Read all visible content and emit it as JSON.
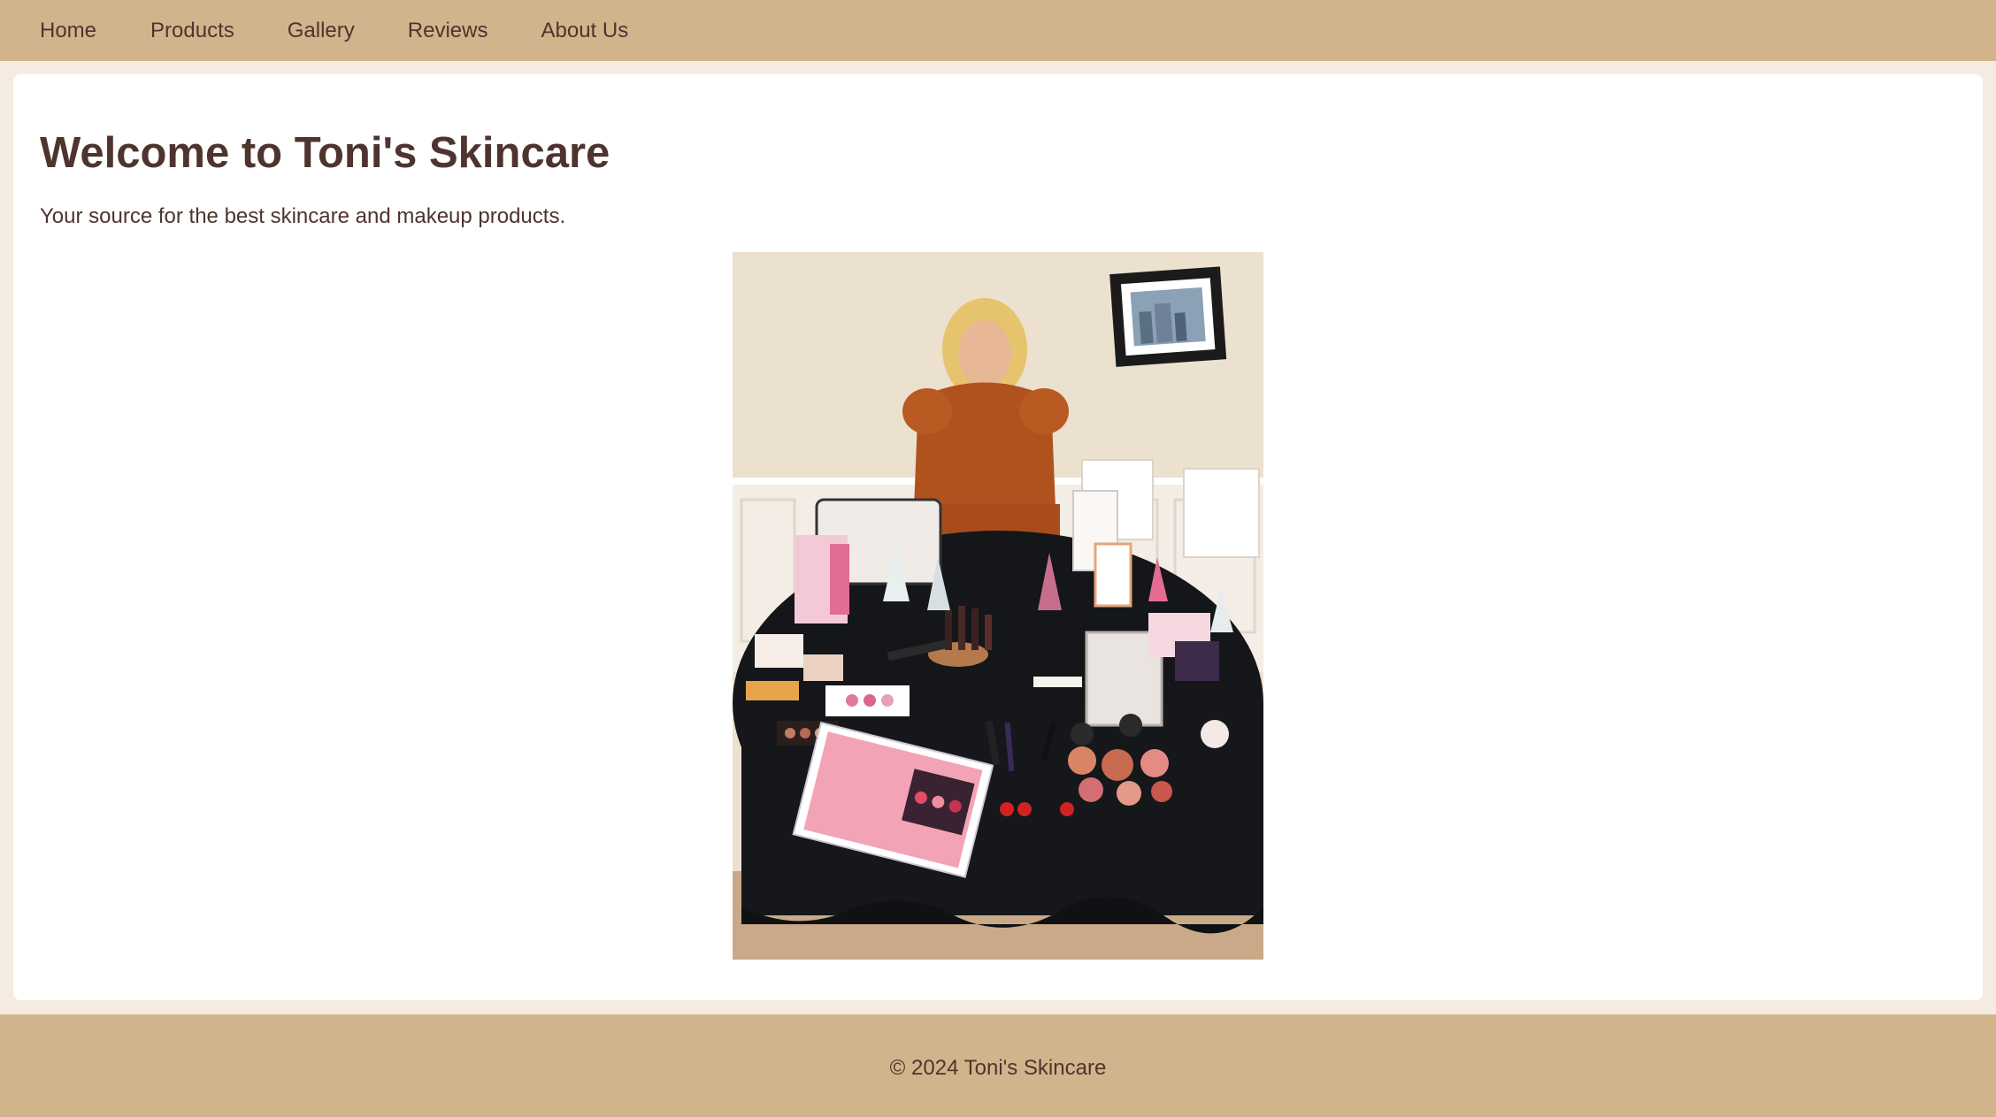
{
  "nav": {
    "items": [
      {
        "label": "Home"
      },
      {
        "label": "Products"
      },
      {
        "label": "Gallery"
      },
      {
        "label": "Reviews"
      },
      {
        "label": "About Us"
      }
    ]
  },
  "hero": {
    "title": "Welcome to Toni's Skincare",
    "subtitle": "Your source for the best skincare and makeup products."
  },
  "footer": {
    "text": "© 2024 Toni's Skincare"
  },
  "colors": {
    "nav_background": "#d2b48c",
    "page_background": "#f5ebe0",
    "card_background": "#ffffff",
    "text": "#4e342e"
  }
}
